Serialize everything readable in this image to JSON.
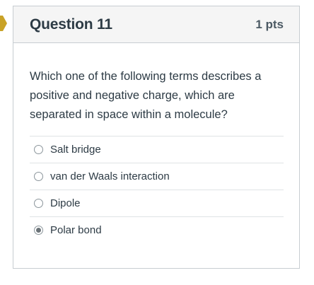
{
  "question": {
    "title": "Question 11",
    "points": "1 pts",
    "text": "Which one of the following terms describes a positive and negative charge, which are separated in space within a molecule?",
    "answers": [
      {
        "label": "Salt bridge",
        "selected": false
      },
      {
        "label": "van der Waals interaction",
        "selected": false
      },
      {
        "label": "Dipole",
        "selected": false
      },
      {
        "label": "Polar bond",
        "selected": true
      }
    ]
  },
  "colors": {
    "marker": "#c9a227",
    "header_bg": "#f5f5f5",
    "border": "#c7cdd1",
    "text": "#2d3b45"
  },
  "icons": {
    "marker": "bookmark-arrow-icon"
  }
}
